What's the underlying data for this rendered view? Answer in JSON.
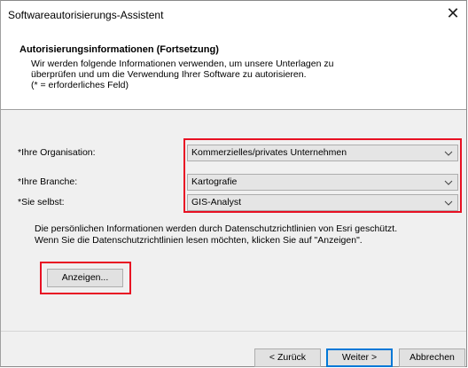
{
  "window": {
    "title": "Softwareautorisierungs-Assistent",
    "close_glyph": "✕"
  },
  "header": {
    "title": "Autorisierungsinformationen (Fortsetzung)",
    "description": "Wir werden folgende Informationen verwenden, um unsere Unterlagen zu\nüberprüfen und um die Verwendung Ihrer Software zu autorisieren.\n(* = erforderliches Feld)"
  },
  "form": {
    "fields": [
      {
        "label": "*Ihre Organisation:",
        "value": "Kommerzielles/privates Unternehmen"
      },
      {
        "label": "*Ihre Branche:",
        "value": "Kartografie"
      },
      {
        "label": "*Sie selbst:",
        "value": "GIS-Analyst"
      }
    ]
  },
  "privacy": {
    "text": "Die persönlichen Informationen werden durch Datenschutzrichtlinien von Esri geschützt.\nWenn Sie die Datenschutzrichtlinien lesen möchten, klicken Sie auf \"Anzeigen\".",
    "show_button": "Anzeigen..."
  },
  "footer": {
    "back_button": "< Zurück",
    "next_button": "Weiter >",
    "cancel_button": "Abbrechen"
  },
  "icons": {
    "dropdown": "chevron-down-icon",
    "close": "close-icon"
  },
  "colors": {
    "highlight": "#e81123",
    "primary_button_border": "#0078d7",
    "dialog_background": "#f0f0f0",
    "header_background": "#ffffff"
  }
}
